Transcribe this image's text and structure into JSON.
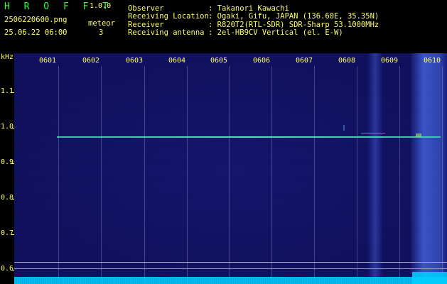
{
  "header": {
    "app_title": "H R O F F T",
    "version": "1.0.0",
    "filename": "2506220600.png",
    "datetime": "25.06.22 06:00",
    "mode_label": "meteor",
    "meteor_count": "3",
    "info": [
      {
        "key": "Observer",
        "value": ": Takanori Kawachi"
      },
      {
        "key": "Receiving Location",
        "value": ": Ogaki, Gifu, JAPAN (136.60E, 35.35N)"
      },
      {
        "key": "Receiver",
        "value": ": R820T2(RTL-SDR) SDR-Sharp 53.1000MHz"
      },
      {
        "key": "Receiving antenna",
        "value": ": 2el-HB9CV Vertical (el. E-W)"
      }
    ]
  },
  "plot": {
    "y_unit": "kHz",
    "y_ticks": [
      "1.1",
      "1.0",
      "0.9",
      "0.8",
      "0.7",
      "0.6"
    ],
    "x_ticks": [
      "0601",
      "0602",
      "0603",
      "0604",
      "0605",
      "0606",
      "0607",
      "0608",
      "0609",
      "0610"
    ]
  },
  "colors": {
    "background": "#000000",
    "label": "#ffff66",
    "title": "#33ff33",
    "carrier": "#4fe8c8",
    "noise": "#00e0ff"
  }
}
